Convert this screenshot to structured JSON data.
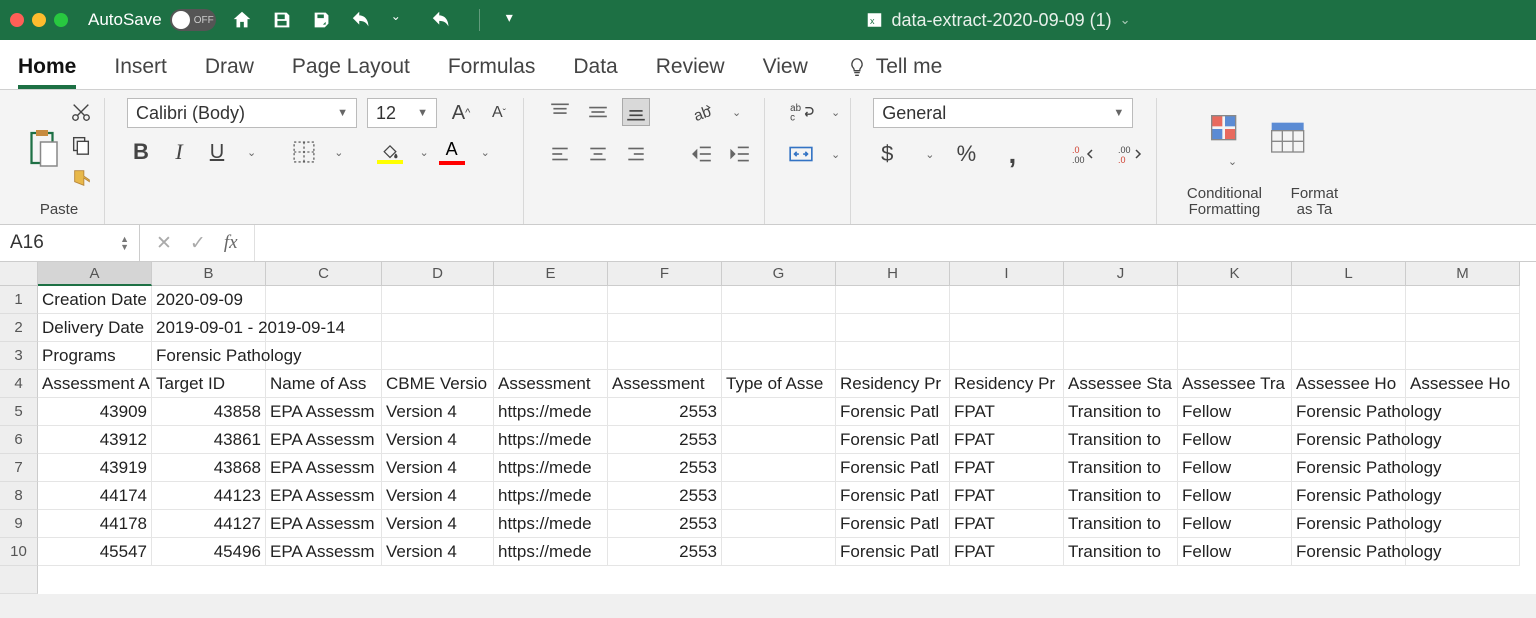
{
  "titlebar": {
    "autosave_label": "AutoSave",
    "autosave_state": "OFF",
    "filename": "data-extract-2020-09-09 (1)"
  },
  "tabs": [
    "Home",
    "Insert",
    "Draw",
    "Page Layout",
    "Formulas",
    "Data",
    "Review",
    "View"
  ],
  "tellme": "Tell me",
  "ribbon": {
    "paste": "Paste",
    "font_name": "Calibri (Body)",
    "font_size": "12",
    "number_format": "General",
    "cond_fmt": "Conditional Formatting",
    "fmt_table": "Format as Ta"
  },
  "namebox": "A16",
  "columns": [
    "A",
    "B",
    "C",
    "D",
    "E",
    "F",
    "G",
    "H",
    "I",
    "J",
    "K",
    "L",
    "M"
  ],
  "selected_col": "A",
  "rows": [
    {
      "n": 1,
      "A": "Creation Date",
      "B": "2020-09-09"
    },
    {
      "n": 2,
      "A": "Delivery Date",
      "B": "2019-09-01 - 2019-09-14",
      "B_overflow": true
    },
    {
      "n": 3,
      "A": "Programs",
      "B": "Forensic Pathology",
      "B_overflow": true
    },
    {
      "n": 4,
      "A": "Assessment A",
      "B": "Target ID",
      "C": "Name of Ass",
      "D": "CBME Versio",
      "E": "Assessment",
      "F": "Assessment",
      "G": "Type of Asse",
      "H": "Residency Pr",
      "I": "Residency Pr",
      "J": "Assessee Sta",
      "K": "Assessee Tra",
      "L": "Assessee Ho",
      "M": "Assessee Ho"
    },
    {
      "n": 5,
      "A": "43909",
      "B": "43858",
      "C": "EPA Assessm",
      "D": "Version 4",
      "E": "https://mede",
      "F": "2553",
      "H": "Forensic Patl",
      "I": "FPAT",
      "J": "Transition to",
      "K": "Fellow",
      "L": "Forensic Pathology"
    },
    {
      "n": 6,
      "A": "43912",
      "B": "43861",
      "C": "EPA Assessm",
      "D": "Version 4",
      "E": "https://mede",
      "F": "2553",
      "H": "Forensic Patl",
      "I": "FPAT",
      "J": "Transition to",
      "K": "Fellow",
      "L": "Forensic Pathology"
    },
    {
      "n": 7,
      "A": "43919",
      "B": "43868",
      "C": "EPA Assessm",
      "D": "Version 4",
      "E": "https://mede",
      "F": "2553",
      "H": "Forensic Patl",
      "I": "FPAT",
      "J": "Transition to",
      "K": "Fellow",
      "L": "Forensic Pathology"
    },
    {
      "n": 8,
      "A": "44174",
      "B": "44123",
      "C": "EPA Assessm",
      "D": "Version 4",
      "E": "https://mede",
      "F": "2553",
      "H": "Forensic Patl",
      "I": "FPAT",
      "J": "Transition to",
      "K": "Fellow",
      "L": "Forensic Pathology"
    },
    {
      "n": 9,
      "A": "44178",
      "B": "44127",
      "C": "EPA Assessm",
      "D": "Version 4",
      "E": "https://mede",
      "F": "2553",
      "H": "Forensic Patl",
      "I": "FPAT",
      "J": "Transition to",
      "K": "Fellow",
      "L": "Forensic Pathology"
    },
    {
      "n": 10,
      "A": "45547",
      "B": "45496",
      "C": "EPA Assessm",
      "D": "Version 4",
      "E": "https://mede",
      "F": "2553",
      "H": "Forensic Patl",
      "I": "FPAT",
      "J": "Transition to",
      "K": "Fellow",
      "L": "Forensic Pathology"
    }
  ]
}
